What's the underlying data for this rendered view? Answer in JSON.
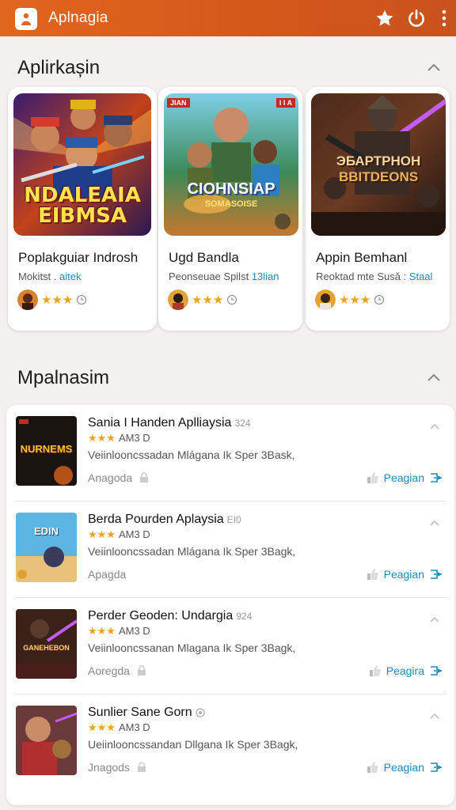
{
  "header": {
    "title": "Aplnagia",
    "accent": "#d85a1b"
  },
  "featured": {
    "title": "Aplirkașin",
    "cards": [
      {
        "art_title": "NDALEAIA EIBMSA",
        "name": "Poplakguiar Indrosh",
        "sub_left": "Mokitst .",
        "sub_link": "aitek",
        "stars": "★★★",
        "rating_icon": "clock-icon"
      },
      {
        "art_title": "CIOHNSIAP",
        "art_sub": "SOMASOISE",
        "badge_left": "JIAN",
        "badge_right": "I I A",
        "name": "Ugd Bandla",
        "sub_left": "Peonseuae Spilst",
        "sub_link": "13lian",
        "stars": "★★★",
        "rating_icon": "clock-icon"
      },
      {
        "art_title": "ЭБАРТРНОН",
        "art_sub": "BBITDEONS",
        "name": "Appin Bemhanl",
        "sub_left": "Reoktad mte Susă :",
        "sub_link": "Staal",
        "stars": "★★★",
        "rating_icon": "clock-icon"
      }
    ]
  },
  "list": {
    "title": "Mpalnasim",
    "items": [
      {
        "thumb_text": "NURNEMS",
        "title": "Sania I Handen Aplliaysia",
        "tag": "324",
        "stars": "★★★",
        "rating": "AM3 D",
        "desc": "Veiinlooncssadan Mlágana Ik Sper 3Bask,",
        "status": "Anagoda",
        "action": "Peagian"
      },
      {
        "thumb_text": "EDIN",
        "title": "Berda Pourden Aplaysia",
        "tag": "EI0",
        "stars": "★★★",
        "rating": "AM3 D",
        "desc": "Veiinlooncssadan Mlágana Ik Sper 3Bagk,",
        "status": "Apagda",
        "action": "Peagian"
      },
      {
        "thumb_text": "GANEHEBON",
        "title": "Perder Geoden: Undargia",
        "tag": "924",
        "stars": "★★★",
        "rating": "AM3 D",
        "desc": "Veiinlooncssanan Mlagana Ik Sper 3Bagk,",
        "status": "Aoregda",
        "action": "Peagira"
      },
      {
        "thumb_text": "",
        "title": "Sunlier Sane Gorn",
        "tag": "",
        "stars": "★★★",
        "rating": "AM3 D",
        "desc": "Ueiinlooncssandan Dllgana Ik Sper 3Bagk,",
        "status": "Jnagods",
        "action": "Peagian"
      }
    ]
  }
}
